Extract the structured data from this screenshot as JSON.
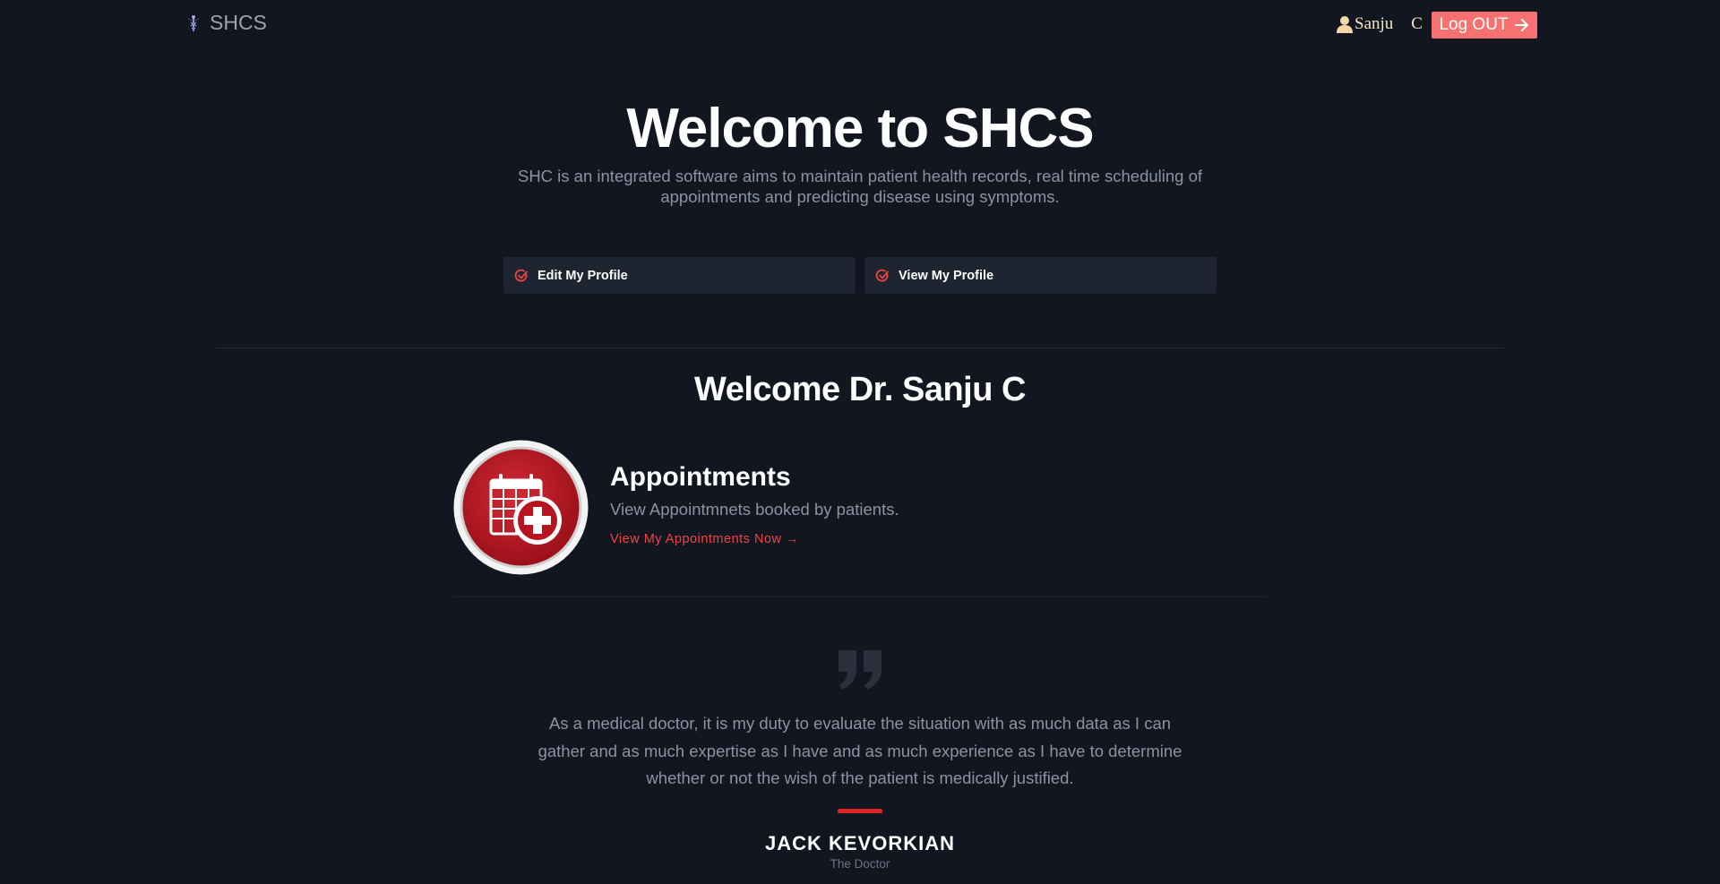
{
  "nav": {
    "brand": "SHCS",
    "user_first": "Sanju",
    "user_last": "C",
    "logout_label": "Log OUT"
  },
  "hero": {
    "title": "Welcome to SHCS",
    "subtitle": "SHC is an integrated software aims to maintain patient health records, real time scheduling of appointments and predicting disease using symptoms."
  },
  "actions": [
    {
      "label": "Edit My Profile",
      "icon": "check-circle-icon"
    },
    {
      "label": "View My Profile",
      "icon": "check-circle-icon"
    }
  ],
  "doctor": {
    "welcome": "Welcome Dr. Sanju C"
  },
  "appointments": {
    "title": "Appointments",
    "description": "View Appointmnets booked by patients.",
    "link": "View My Appointments Now →",
    "icon": "medical-calendar-icon"
  },
  "testimonial": {
    "quote": "As a medical doctor, it is my duty to evaluate the situation with as much data as I can gather and as much expertise as I have and as much experience as I have to determine whether or not the wish of the patient is medically justified.",
    "author": "JACK KEVORKIAN",
    "role": "The Doctor"
  },
  "colors": {
    "background": "#121620",
    "accent": "#ef4444",
    "logout_bg": "#f87171",
    "card_bg": "#1f2530",
    "muted_text": "#8b93a1"
  }
}
